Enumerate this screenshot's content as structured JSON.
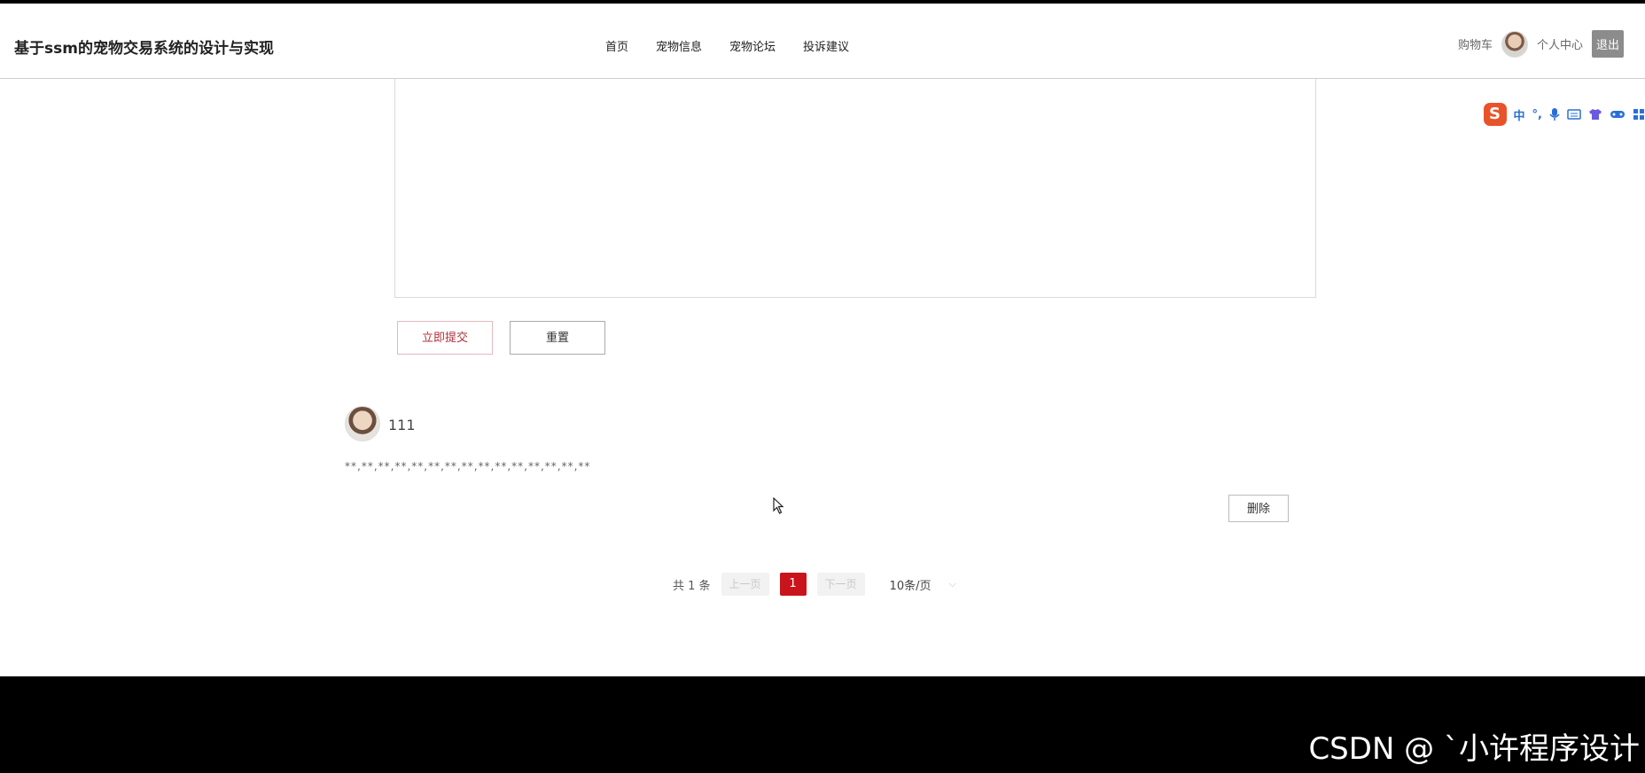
{
  "header": {
    "site_title": "基于ssm的宠物交易系统的设计与实现",
    "nav": [
      "首页",
      "宠物信息",
      "宠物论坛",
      "投诉建议"
    ],
    "cart": "购物车",
    "profile": "个人中心",
    "logout": "退出"
  },
  "ime_toolbar": {
    "logo": "S",
    "mode": "中",
    "punct": "°,"
  },
  "form": {
    "submit_label": "立即提交",
    "reset_label": "重置"
  },
  "comment": {
    "username": "111",
    "text": "**,**,**,**,**,**,**,**,**,**,**,**,**,**,**",
    "delete_label": "删除"
  },
  "pagination": {
    "total": "共 1 条",
    "prev": "上一页",
    "current": "1",
    "next": "下一页",
    "page_size": "10条/页"
  },
  "watermark": "CSDN @ ˋ小许程序设计"
}
